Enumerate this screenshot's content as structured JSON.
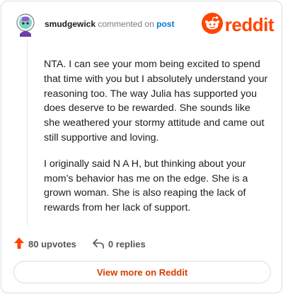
{
  "header": {
    "username": "smudgewick",
    "action": "commented on",
    "post_link": "post",
    "logo_text": "reddit"
  },
  "comment": {
    "paragraphs": [
      "NTA. I can see your mom being excited to spend that time with you but I absolutely understand your reasoning too. The way Julia has supported you does deserve to be rewarded. She sounds like she weathered your stormy attitude and came out still supportive and loving.",
      "I originally said N A H, but thinking about your mom’s behavior has me on the edge. She is a grown woman. She is also reaping the lack of rewards from her lack of support."
    ]
  },
  "actions": {
    "upvotes": "80 upvotes",
    "replies": "0 replies"
  },
  "footer": {
    "view_more": "View more on Reddit"
  },
  "colors": {
    "brand": "#ff4500",
    "link": "#0079d3",
    "cta": "#d93a00"
  }
}
